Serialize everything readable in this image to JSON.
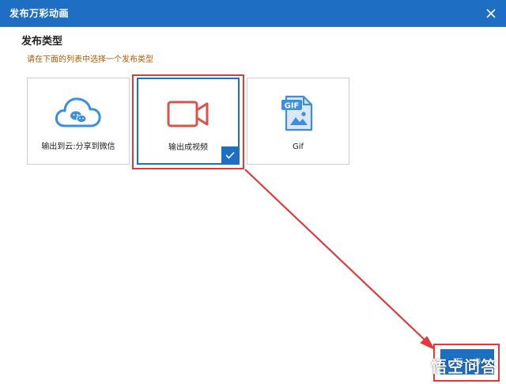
{
  "window": {
    "title": "发布万彩动画"
  },
  "section": {
    "title": "发布类型",
    "hint": "请在下面的列表中选择一个发布类型"
  },
  "cards": [
    {
      "label": "输出到云:分享到微信",
      "icon": "cloud-wechat-icon",
      "selected": false
    },
    {
      "label": "输出成视频",
      "icon": "video-camera-icon",
      "selected": true
    },
    {
      "label": "Gif",
      "icon": "gif-file-icon",
      "selected": false
    }
  ],
  "next_button": {
    "label": "下一步"
  },
  "watermark": {
    "text": "悟空问答"
  },
  "colors": {
    "accent": "#1e6fc4",
    "annotation": "#e23a3a",
    "hint": "#b25a00"
  }
}
